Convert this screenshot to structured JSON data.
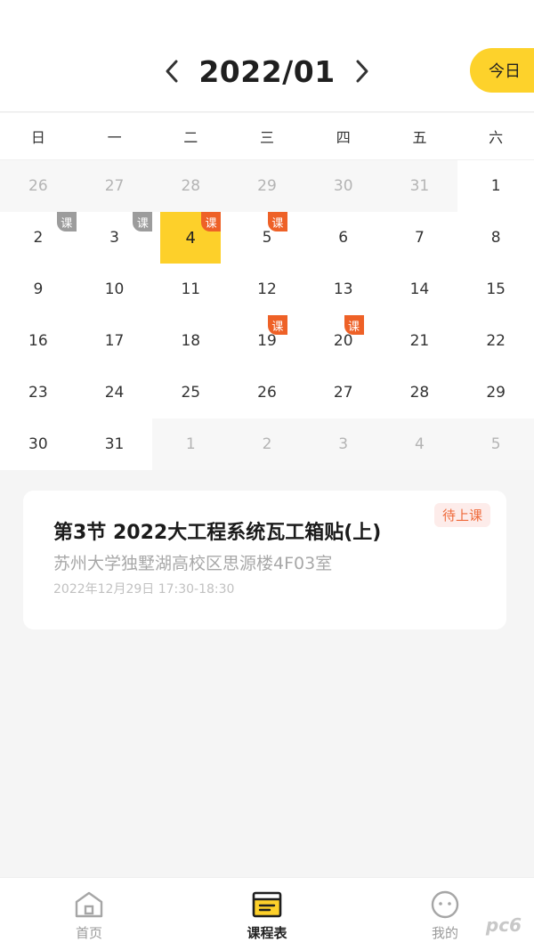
{
  "header": {
    "month": "2022/01",
    "today_label": "今日"
  },
  "calendar": {
    "weekdays": [
      "日",
      "一",
      "二",
      "三",
      "四",
      "五",
      "六"
    ],
    "days": [
      {
        "day": "26",
        "other": true
      },
      {
        "day": "27",
        "other": true
      },
      {
        "day": "28",
        "other": true
      },
      {
        "day": "29",
        "other": true
      },
      {
        "day": "30",
        "other": true
      },
      {
        "day": "31",
        "other": true
      },
      {
        "day": "1"
      },
      {
        "day": "2",
        "badge": "课",
        "badge_style": "gray"
      },
      {
        "day": "3",
        "badge": "课",
        "badge_style": "gray"
      },
      {
        "day": "4",
        "badge": "课",
        "badge_style": "orange",
        "selected": true
      },
      {
        "day": "5",
        "badge": "课",
        "badge_style": "orange"
      },
      {
        "day": "6"
      },
      {
        "day": "7"
      },
      {
        "day": "8"
      },
      {
        "day": "9"
      },
      {
        "day": "10"
      },
      {
        "day": "11"
      },
      {
        "day": "12"
      },
      {
        "day": "13"
      },
      {
        "day": "14"
      },
      {
        "day": "15"
      },
      {
        "day": "16"
      },
      {
        "day": "17"
      },
      {
        "day": "18"
      },
      {
        "day": "19",
        "badge": "课",
        "badge_style": "orange"
      },
      {
        "day": "20",
        "badge": "课",
        "badge_style": "orange"
      },
      {
        "day": "21"
      },
      {
        "day": "22"
      },
      {
        "day": "23"
      },
      {
        "day": "24"
      },
      {
        "day": "25"
      },
      {
        "day": "26"
      },
      {
        "day": "27"
      },
      {
        "day": "28"
      },
      {
        "day": "29"
      },
      {
        "day": "30"
      },
      {
        "day": "31"
      },
      {
        "day": "1",
        "other": true
      },
      {
        "day": "2",
        "other": true
      },
      {
        "day": "3",
        "other": true
      },
      {
        "day": "4",
        "other": true
      },
      {
        "day": "5",
        "other": true
      }
    ]
  },
  "course": {
    "status": "待上课",
    "title": "第3节 2022大工程系统瓦工箱贴(上)",
    "location": "苏州大学独墅湖高校区思源楼4F03室",
    "time": "2022年12月29日  17:30-18:30"
  },
  "tabbar": {
    "tabs": [
      {
        "label": "首页",
        "icon": "home-icon"
      },
      {
        "label": "课程表",
        "icon": "schedule-icon",
        "active": true
      },
      {
        "label": "我的",
        "icon": "profile-icon"
      }
    ]
  },
  "watermark": "pc6",
  "colors": {
    "accent": "#fdd02a",
    "badge_orange": "#ee6127",
    "badge_gray": "#9c9c9c",
    "status_text": "#ef6a3a"
  }
}
